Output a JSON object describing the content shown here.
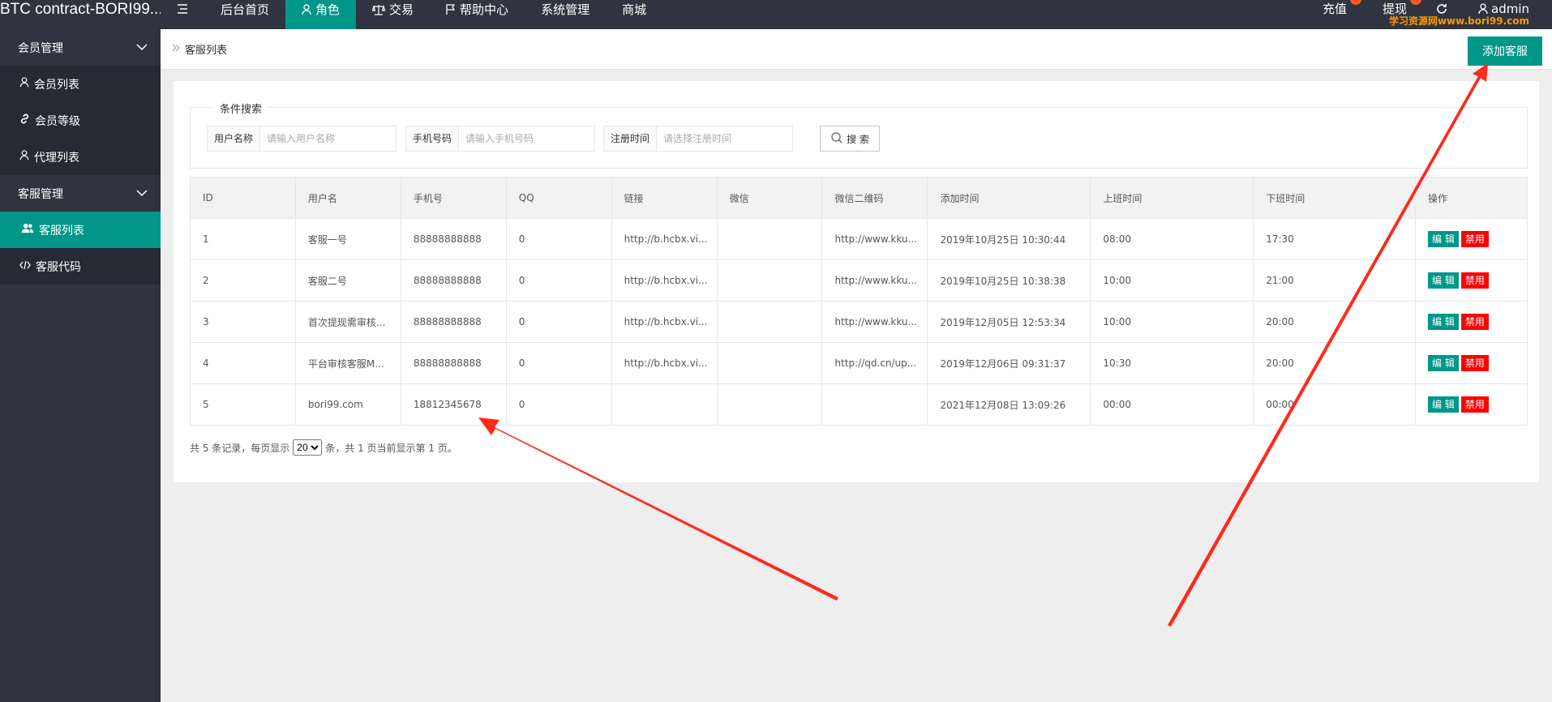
{
  "app": {
    "title": "BTC contract-BORI99..."
  },
  "nav": {
    "items": [
      {
        "label": "后台首页",
        "icon": ""
      },
      {
        "label": "角色",
        "icon": "person-icon"
      },
      {
        "label": "交易",
        "icon": "scale-icon"
      },
      {
        "label": "帮助中心",
        "icon": "flag-icon"
      },
      {
        "label": "系统管理",
        "icon": ""
      },
      {
        "label": "商城",
        "icon": ""
      }
    ],
    "recharge": "充值",
    "withdraw": "提现",
    "user": "admin",
    "watermark": "学习资源网www.bori99.com"
  },
  "sidebar": {
    "groups": [
      {
        "label": "会员管理",
        "items": [
          "会员列表",
          "会员等级",
          "代理列表"
        ]
      },
      {
        "label": "客服管理",
        "items": [
          "客服列表",
          "客服代码"
        ]
      }
    ]
  },
  "header": {
    "breadcrumb": "客服列表",
    "add_button": "添加客服"
  },
  "search": {
    "legend": "条件搜索",
    "username_label": "用户名称",
    "username_placeholder": "请输入用户名称",
    "phone_label": "手机号码",
    "phone_placeholder": "请输入手机号码",
    "regtime_label": "注册时间",
    "regtime_placeholder": "请选择注册时间",
    "button": "搜 索"
  },
  "table": {
    "headers": [
      "ID",
      "用户名",
      "手机号",
      "QQ",
      "链接",
      "微信",
      "微信二维码",
      "添加时间",
      "上班时间",
      "下班时间",
      "操作"
    ],
    "rows": [
      [
        "1",
        "客服一号",
        "88888888888",
        "0",
        "http://b.hcbx.vi...",
        "",
        "http://www.kku...",
        "2019年10月25日 10:30:44",
        "08:00",
        "17:30"
      ],
      [
        "2",
        "客服二号",
        "88888888888",
        "0",
        "http://b.hcbx.vi...",
        "",
        "http://www.kku...",
        "2019年10月25日 10:38:38",
        "10:00",
        "21:00"
      ],
      [
        "3",
        "首次提现需审核...",
        "88888888888",
        "0",
        "http://b.hcbx.vi...",
        "",
        "http://www.kku...",
        "2019年12月05日 12:53:34",
        "10:00",
        "20:00"
      ],
      [
        "4",
        "平台审核客服M...",
        "88888888888",
        "0",
        "http://b.hcbx.vi...",
        "",
        "http://qd.cn/up...",
        "2019年12月06日 09:31:37",
        "10:30",
        "20:00"
      ],
      [
        "5",
        "bori99.com",
        "18812345678",
        "0",
        "",
        "",
        "",
        "2021年12月08日 13:09:26",
        "00:00",
        "00:00"
      ]
    ],
    "edit_label": "编 辑",
    "ban_label": "禁用"
  },
  "pager": {
    "prefix": "共 5 条记录，每页显示",
    "page_size": "20",
    "suffix": "条，共 1 页当前显示第 1 页。"
  },
  "colors": {
    "accent": "#009688",
    "topbar": "#2f3440",
    "danger": "#ff0000",
    "annotation": "#ff2a1a"
  }
}
